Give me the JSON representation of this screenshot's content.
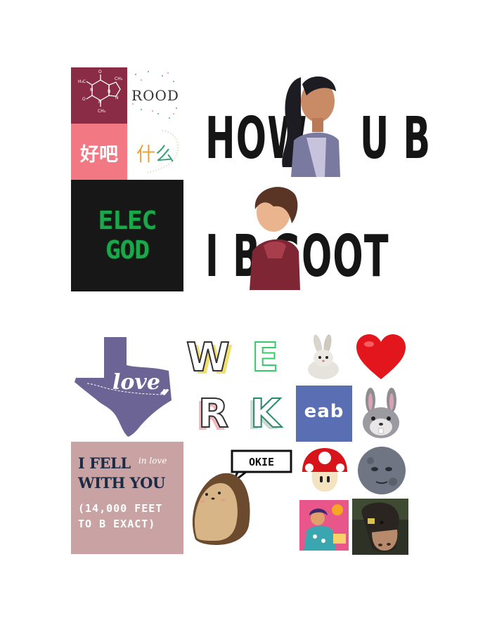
{
  "stickers": {
    "rood": "ROOD",
    "haoba": "好吧",
    "shenme": [
      "什",
      "么"
    ],
    "elec_god": [
      "ELEC",
      "GOD"
    ],
    "how_u_b": [
      "HOW",
      "U B"
    ],
    "i_b_goot": [
      "I B",
      "GOOT"
    ],
    "love": "love",
    "werk": [
      "W",
      "E",
      "R",
      "K"
    ],
    "eab": "eab",
    "fell": {
      "line1": "I FELL",
      "script": "in love",
      "line2": "WITH YOU",
      "line3": "(14,000 FEET",
      "line4": "TO B EXACT)"
    },
    "okie": "OKIE"
  },
  "colors": {
    "caffeine_bg": "#8a2c45",
    "haoba_bg": "#f27983",
    "elec_bg": "#161716",
    "texas": "#6b6494",
    "eab_bg": "#5a6eb4",
    "fell_bg": "#c9a3a3"
  },
  "icons": [
    "caffeine-molecule-icon",
    "girl-ponytail-icon",
    "boy-hoodie-icon",
    "texas-map-icon",
    "bunny-plush-icon",
    "red-heart-icon",
    "rabbit-face-icon",
    "hedgehog-icon",
    "mushroom-icon",
    "moon-face-icon",
    "girl-illustration-icon",
    "cow-icon"
  ]
}
